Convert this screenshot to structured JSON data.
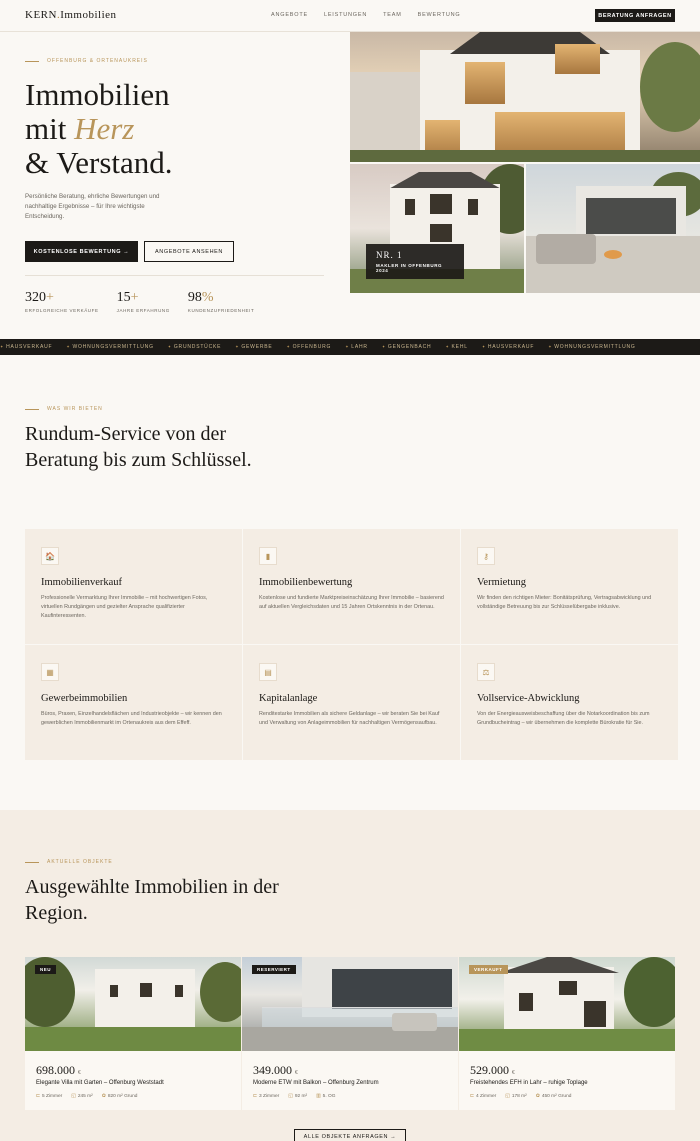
{
  "nav": {
    "logo_main": "KERN",
    "logo_dot": ".",
    "logo_rest": "Immobilien",
    "links": [
      "ANGEBOTE",
      "LEISTUNGEN",
      "TEAM",
      "BEWERTUNG"
    ],
    "cta": "BERATUNG ANFRAGEN"
  },
  "hero": {
    "eyebrow": "OFFENBURG & ORTENAUKREIS",
    "title_line1": "Immobilien",
    "title_line2_pre": "mit ",
    "title_line2_em": "Herz",
    "title_line3": "& Verstand.",
    "lead": "Persönliche Beratung, ehrliche Bewertungen und nachhaltige Ergebnisse – für Ihre wichtigste Entscheidung.",
    "primary_cta": "KOSTENLOSE BEWERTUNG →",
    "secondary_cta": "ANGEBOTE ANSEHEN",
    "stats": [
      {
        "num": "320",
        "plus": "+",
        "label": "ERFOLGREICHE VERKÄUFE"
      },
      {
        "num": "15",
        "plus": "+",
        "label": "JAHRE ERFAHRUNG"
      },
      {
        "num": "98",
        "plus": "%",
        "label": "KUNDENZUFRIEDENHEIT"
      }
    ],
    "badge_title": "NR. 1",
    "badge_sub": "MAKLER IN OFFENBURG 2024"
  },
  "ticker": [
    "HAUSVERKAUF",
    "WOHNUNGSVERMITTLUNG",
    "GRUNDSTÜCKE",
    "GEWERBE",
    "OFFENBURG",
    "LAHR",
    "GENGENBACH",
    "KEHL",
    "HAUSVERKAUF",
    "WOHNUNGSVERMITTLUNG"
  ],
  "services": {
    "eyebrow": "WAS WIR BIETEN",
    "title": "Rundum-Service von der Beratung bis zum Schlüssel.",
    "items": [
      {
        "icon": "🏠",
        "title": "Immobilienverkauf",
        "text": "Professionelle Vermarktung Ihrer Immobilie – mit hochwertigen Fotos, virtuellen Rundgängen und gezielter Ansprache qualifizierter Kaufinteressenten."
      },
      {
        "icon": "▮",
        "title": "Immobilienbewertung",
        "text": "Kostenlose und fundierte Marktpreiseinschätzung Ihrer Immobilie – basierend auf aktuellen Vergleichsdaten und 15 Jahren Ortskenntnis in der Ortenau."
      },
      {
        "icon": "⚷",
        "title": "Vermietung",
        "text": "Wir finden den richtigen Mieter: Bonitätsprüfung, Vertragsabwicklung und vollständige Betreuung bis zur Schlüsselübergabe inklusive."
      },
      {
        "icon": "▦",
        "title": "Gewerbeimmobilien",
        "text": "Büros, Praxen, Einzelhandelsflächen und Industrieobjekte – wir kennen den gewerblichen Immobilienmarkt im Ortenaukreis aus dem Effeff."
      },
      {
        "icon": "▤",
        "title": "Kapitalanlage",
        "text": "Renditestarke Immobilien als sichere Geldanlage – wir beraten Sie bei Kauf und Verwaltung von Anlageimmobilien für nachhaltigen Vermögensaufbau."
      },
      {
        "icon": "⚖",
        "title": "Vollservice-Abwicklung",
        "text": "Von der Energieausweisbeschaffung über die Notarkoordination bis zum Grundbucheintrag – wir übernehmen die komplette Bürokratie für Sie."
      }
    ]
  },
  "listings": {
    "eyebrow": "AKTUELLE OBJEKTE",
    "title": "Ausgewählte Immobilien in der Region.",
    "items": [
      {
        "tag": "NEU",
        "price": "698.000",
        "currency": "€",
        "title": "Elegante Villa mit Garten – Offenburg Weststadt",
        "f1": "5 Zimmer",
        "f2": "245 m²",
        "f3": "820 m² Grund"
      },
      {
        "tag": "RESERVIERT",
        "price": "349.000",
        "currency": "€",
        "title": "Moderne ETW mit Balkon – Offenburg Zentrum",
        "f1": "3 Zimmer",
        "f2": "92 m²",
        "f3": "5. OG"
      },
      {
        "tag": "VERKAUFT",
        "price": "529.000",
        "currency": "€",
        "title": "Freistehendes EFH in Lahr – ruhige Toplage",
        "f1": "4 Zimmer",
        "f2": "178 m²",
        "f3": "450 m² Grund"
      }
    ],
    "all_cta": "ALLE OBJEKTE ANFRAGEN →"
  }
}
